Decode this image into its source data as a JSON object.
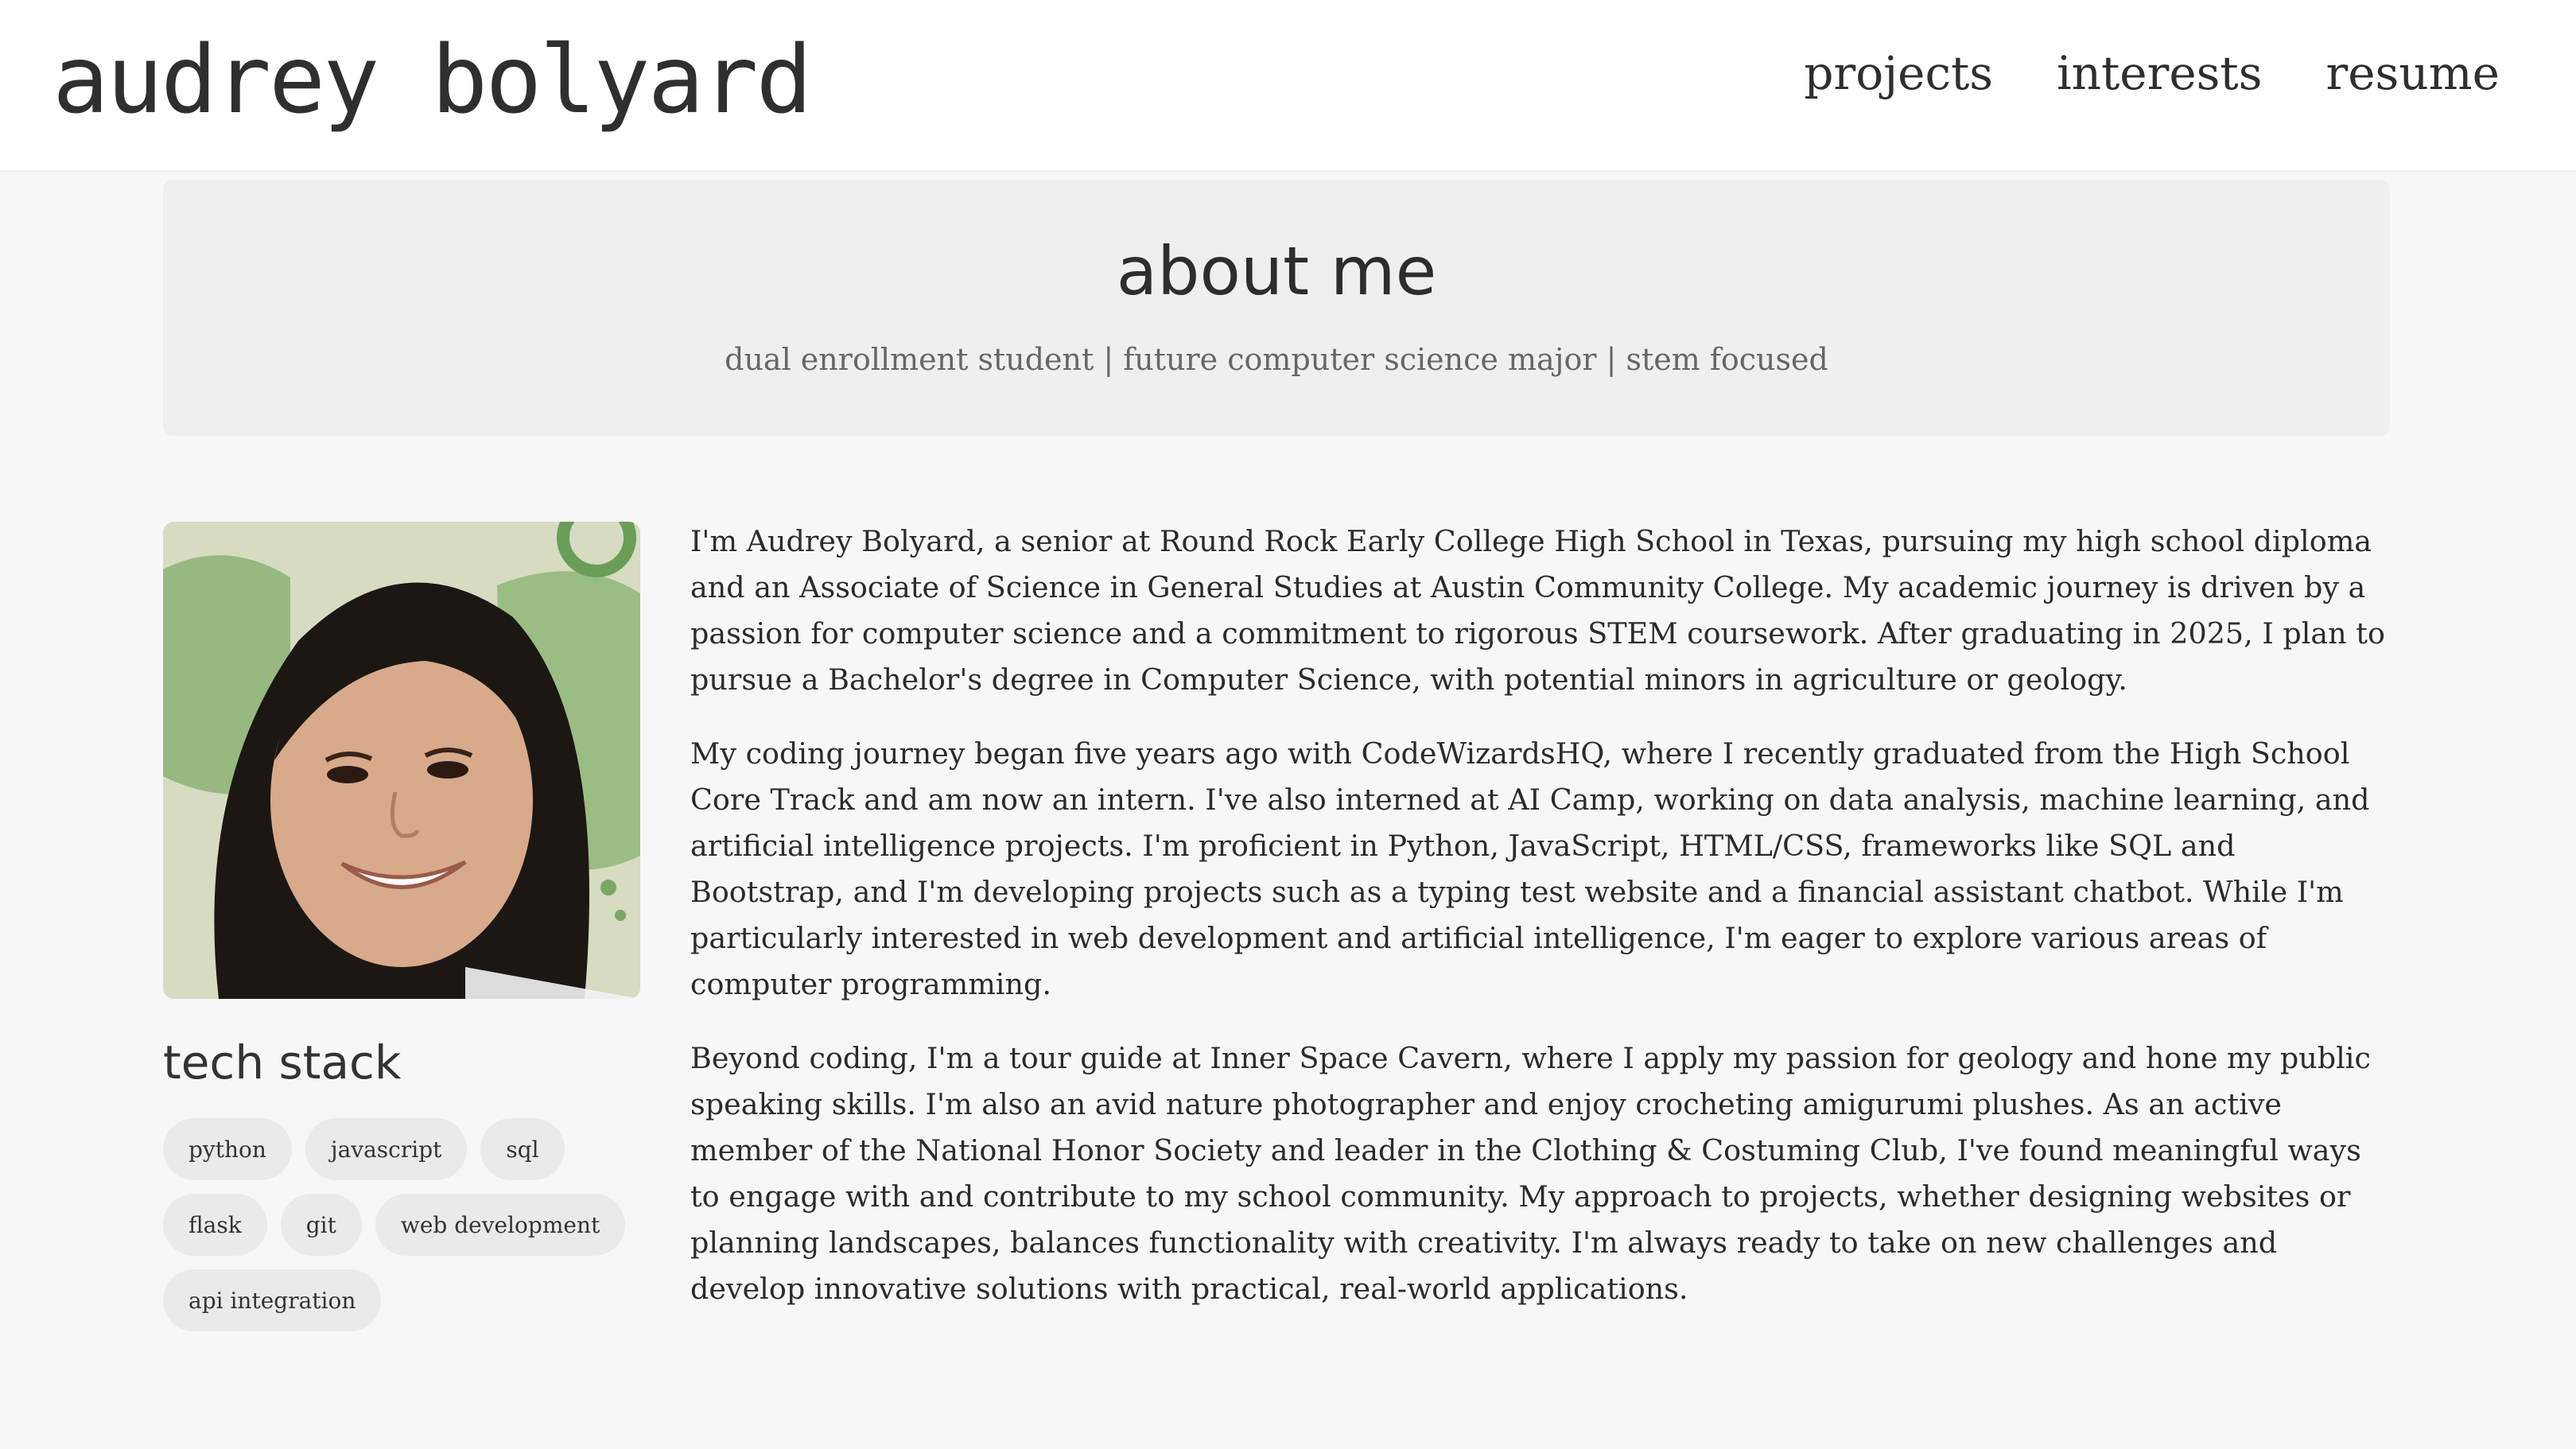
{
  "header": {
    "brand": "audrey bolyard",
    "nav": [
      {
        "label": "projects"
      },
      {
        "label": "interests"
      },
      {
        "label": "resume"
      }
    ]
  },
  "hero": {
    "title": "about me",
    "tagline": "dual enrollment student | future computer science major | stem focused"
  },
  "sidebar": {
    "photo_alt": "portrait photo",
    "tech_title": "tech stack",
    "chips": [
      {
        "label": "python"
      },
      {
        "label": "javascript"
      },
      {
        "label": "sql"
      },
      {
        "label": "flask"
      },
      {
        "label": "git"
      },
      {
        "label": "web development"
      },
      {
        "label": "api integration"
      }
    ]
  },
  "bio": {
    "paragraphs": [
      "I'm Audrey Bolyard, a senior at Round Rock Early College High School in Texas, pursuing my high school diploma and an Associate of Science in General Studies at Austin Community College. My academic journey is driven by a passion for computer science and a commitment to rigorous STEM coursework. After graduating in 2025, I plan to pursue a Bachelor's degree in Computer Science, with potential minors in agriculture or geology.",
      "My coding journey began five years ago with CodeWizardsHQ, where I recently graduated from the High School Core Track and am now an intern. I've also interned at AI Camp, working on data analysis, machine learning, and artificial intelligence projects. I'm proficient in Python, JavaScript, HTML/CSS, frameworks like SQL and Bootstrap, and I'm developing projects such as a typing test website and a financial assistant chatbot. While I'm particularly interested in web development and artificial intelligence, I'm eager to explore various areas of computer programming.",
      "Beyond coding, I'm a tour guide at Inner Space Cavern, where I apply my passion for geology and hone my public speaking skills. I'm also an avid nature photographer and enjoy crocheting amigurumi plushes. As an active member of the National Honor Society and leader in the Clothing & Costuming Club, I've found meaningful ways to engage with and contribute to my school community. My approach to projects, whether designing websites or planning landscapes, balances functionality with creativity. I'm always ready to take on new challenges and develop innovative solutions with practical, real-world applications."
    ]
  },
  "colors": {
    "page_bg": "#f7f7f7",
    "header_bg": "#ffffff",
    "hero_bg": "#efefef",
    "chip_bg": "#eaeaea",
    "text": "#333333",
    "muted": "#666666"
  }
}
